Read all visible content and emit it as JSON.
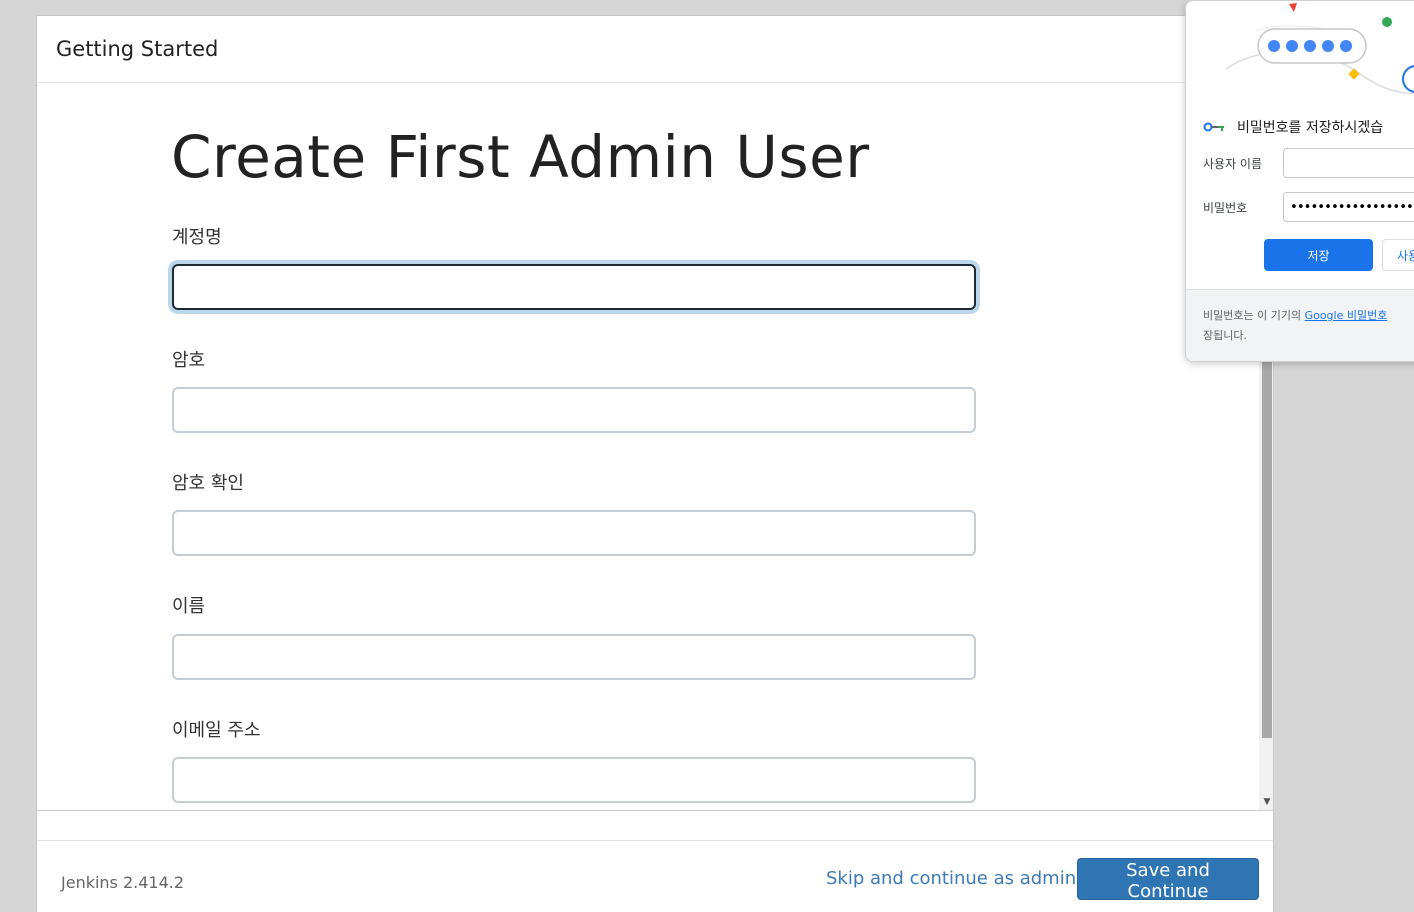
{
  "dialog": {
    "header_title": "Getting Started",
    "page_title": "Create First Admin User",
    "fields": [
      {
        "label": "계정명",
        "value": ""
      },
      {
        "label": "암호",
        "value": ""
      },
      {
        "label": "암호 확인",
        "value": ""
      },
      {
        "label": "이름",
        "value": ""
      },
      {
        "label": "이메일 주소",
        "value": ""
      }
    ],
    "footer": {
      "version": "Jenkins 2.414.2",
      "skip_label": "Skip and continue as admin",
      "save_label": "Save and Continue"
    },
    "scroll_arrow": "▼"
  },
  "password_popup": {
    "title": "비밀번호를 저장하시겠습",
    "username_label": "사용자 이름",
    "username_value": "",
    "password_label": "비밀번호",
    "password_value": "••••••••••••••••••••••",
    "save_label": "저장",
    "never_label": "사용",
    "note_prefix": "비밀번호는 이 기기의 ",
    "note_link": "Google 비밀번호",
    "note_suffix": "장됩니다."
  },
  "colors": {
    "primary_button": "#2f75b4",
    "link": "#3d7ab8",
    "focus_ring": "#bcd6ea",
    "chrome_blue": "#1a73e8"
  }
}
